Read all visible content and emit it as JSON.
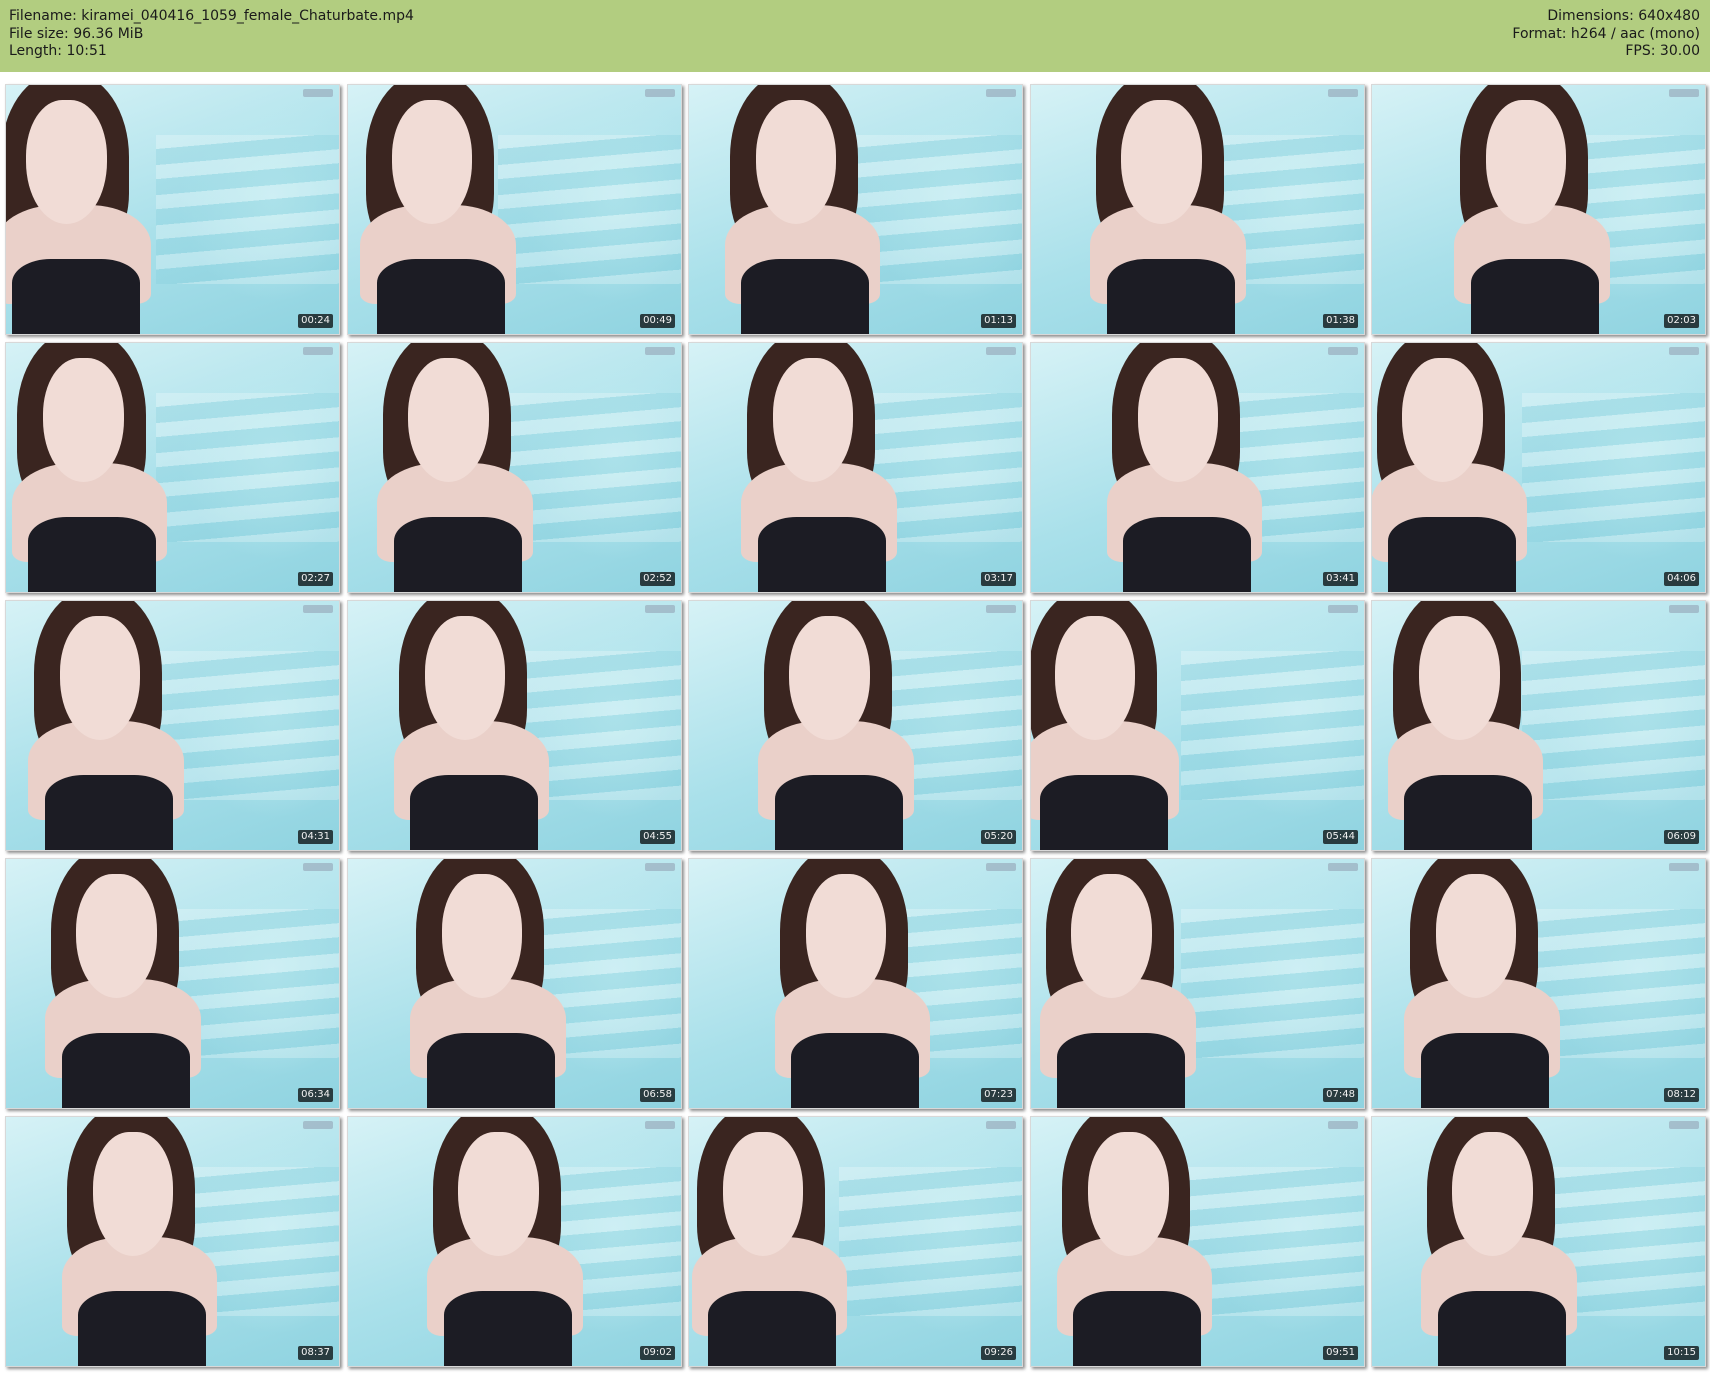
{
  "header": {
    "filename": "Filename: kiramei_040416_1059_female_Chaturbate.mp4",
    "filesize": "File size: 96.36 MiB",
    "length": "Length: 10:51",
    "dimensions": "Dimensions: 640x480",
    "format": "Format: h264 / aac (mono)",
    "fps": "FPS: 30.00"
  },
  "colors": {
    "header_bg": "#b2cd80",
    "timestamp_bg": "#000000"
  },
  "thumbnails": [
    {
      "time": "00:24"
    },
    {
      "time": "00:49"
    },
    {
      "time": "01:13"
    },
    {
      "time": "01:38"
    },
    {
      "time": "02:03"
    },
    {
      "time": "02:27"
    },
    {
      "time": "02:52"
    },
    {
      "time": "03:17"
    },
    {
      "time": "03:41"
    },
    {
      "time": "04:06"
    },
    {
      "time": "04:31"
    },
    {
      "time": "04:55"
    },
    {
      "time": "05:20"
    },
    {
      "time": "05:44"
    },
    {
      "time": "06:09"
    },
    {
      "time": "06:34"
    },
    {
      "time": "06:58"
    },
    {
      "time": "07:23"
    },
    {
      "time": "07:48"
    },
    {
      "time": "08:12"
    },
    {
      "time": "08:37"
    },
    {
      "time": "09:02"
    },
    {
      "time": "09:26"
    },
    {
      "time": "09:51"
    },
    {
      "time": "10:15"
    }
  ]
}
